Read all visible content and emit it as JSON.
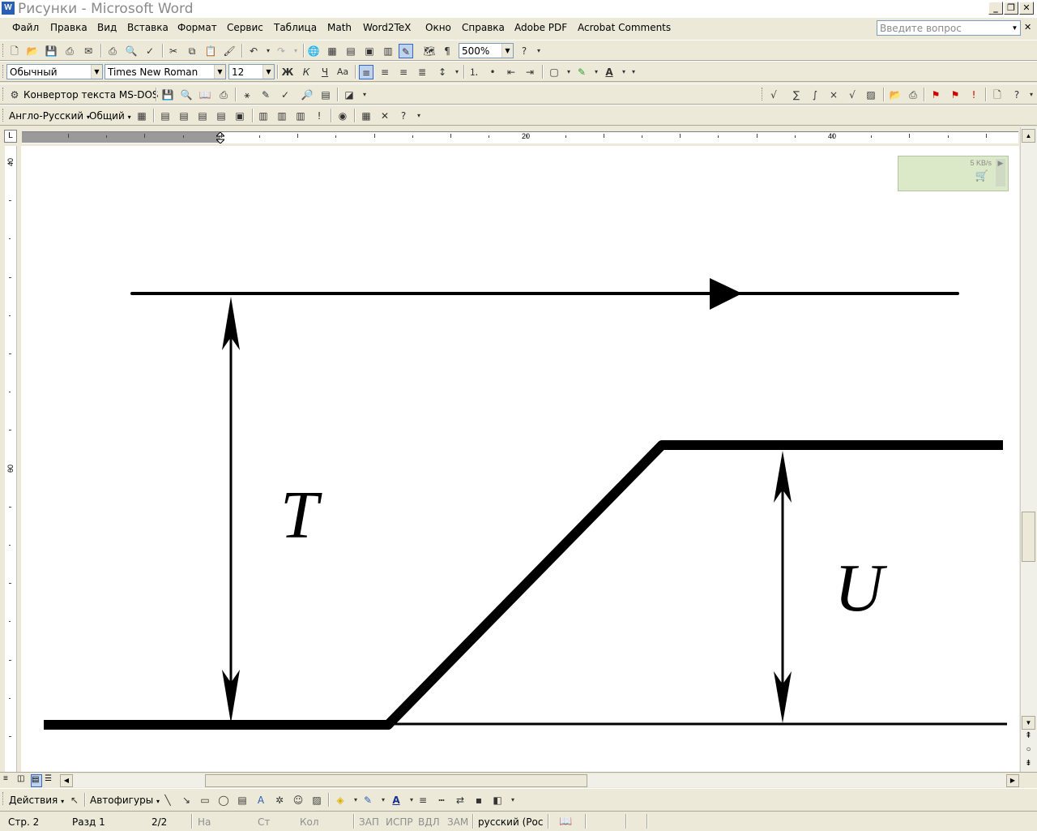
{
  "window": {
    "title": "Рисунки - Microsoft Word",
    "icon": "word-icon",
    "controls": [
      "minimize-icon",
      "restore-icon",
      "close-icon"
    ]
  },
  "menubar": {
    "items": [
      "Файл",
      "Правка",
      "Вид",
      "Вставка",
      "Формат",
      "Сервис",
      "Таблица",
      "Math",
      "Word2TeX",
      "Окно",
      "Справка",
      "Adobe PDF",
      "Acrobat Comments"
    ],
    "ask_placeholder": "Введите вопрос"
  },
  "standard_toolbar": {
    "zoom": "500%"
  },
  "formatting_toolbar": {
    "style": "Обычный",
    "font": "Times New Roman",
    "size": "12",
    "bold": "Ж",
    "italic": "К",
    "underline": "Ч"
  },
  "converter_toolbar": {
    "label": "Конвертор текста MS-DOS"
  },
  "translate_toolbar": {
    "direction": "Англо-Русский",
    "dictionary": "Общий"
  },
  "ruler": {
    "labels": [
      "20",
      "40"
    ],
    "vertical_labels": [
      "40",
      "60"
    ]
  },
  "widget": {
    "rate": "5 KB/s"
  },
  "drawing": {
    "label_T": "T",
    "label_U": "U"
  },
  "drawing_toolbar": {
    "actions": "Действия",
    "autoshapes": "Автофигуры"
  },
  "statusbar": {
    "page": "Стр. 2",
    "section": "Разд 1",
    "pages": "2/2",
    "at": "На",
    "line": "Ст",
    "col": "Кол",
    "rec": "ЗАП",
    "trk": "ИСПР",
    "ext": "ВДЛ",
    "ovr": "ЗАМ",
    "language": "русский (Рос"
  }
}
